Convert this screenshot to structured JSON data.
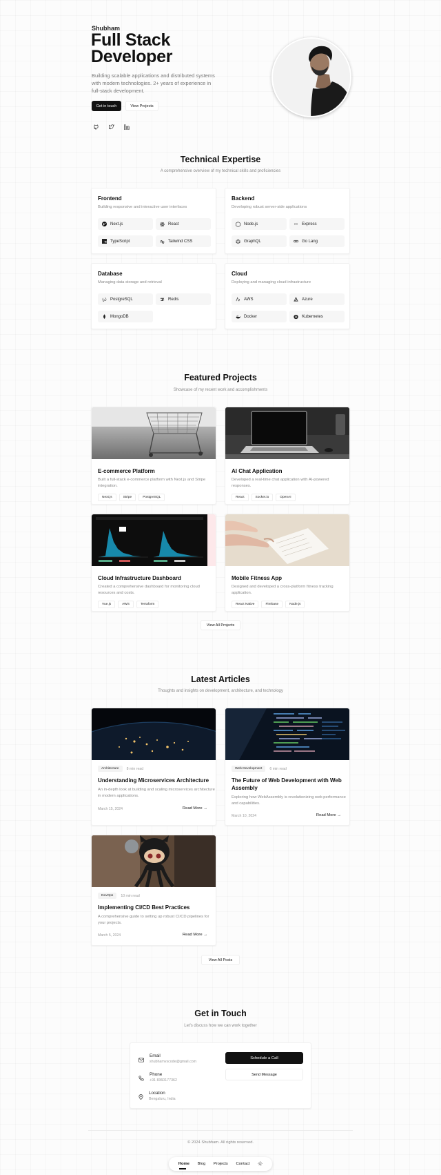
{
  "hero": {
    "name": "Shubham",
    "title_line1": "Full Stack",
    "title_line2": "Developer",
    "description": "Building scalable applications and distributed systems with modern technologies. 2+ years of experience in full-stack development.",
    "primary_button": "Get in touch",
    "secondary_button": "View Projects",
    "social_icons": [
      "github-icon",
      "twitter-icon",
      "linkedin-icon"
    ]
  },
  "skills": {
    "title": "Technical Expertise",
    "subtitle": "A comprehensive overview of my technical skills and proficiencies",
    "cards": [
      {
        "title": "Frontend",
        "desc": "Building responsive and interactive user interfaces",
        "items": [
          "Next.js",
          "React",
          "TypeScript",
          "Tailwind CSS"
        ]
      },
      {
        "title": "Backend",
        "desc": "Developing robust server-side applications",
        "items": [
          "Node.js",
          "Express",
          "GraphQL",
          "Go Lang"
        ]
      },
      {
        "title": "Database",
        "desc": "Managing data storage and retrieval",
        "items": [
          "PostgreSQL",
          "Redis",
          "MongoDB"
        ]
      },
      {
        "title": "Cloud",
        "desc": "Deploying and managing cloud infrastructure",
        "items": [
          "AWS",
          "Azure",
          "Docker",
          "Kubernetes"
        ]
      }
    ]
  },
  "projects": {
    "title": "Featured Projects",
    "subtitle": "Showcase of my recent work and accomplishments",
    "items": [
      {
        "title": "E-commerce Platform",
        "desc": "Built a full-stack e-commerce platform with Next.js and Stripe integration.",
        "tags": [
          "Next.js",
          "Stripe",
          "PostgreSQL"
        ]
      },
      {
        "title": "AI Chat Application",
        "desc": "Developed a real-time chat application with AI-powered responses.",
        "tags": [
          "React",
          "Socket.io",
          "OpenAI"
        ]
      },
      {
        "title": "Cloud Infrastructure Dashboard",
        "desc": "Created a comprehensive dashboard for monitoring cloud resources and costs.",
        "tags": [
          "Vue.js",
          "AWS",
          "Terraform"
        ]
      },
      {
        "title": "Mobile Fitness App",
        "desc": "Designed and developed a cross-platform fitness tracking application.",
        "tags": [
          "React Native",
          "Firebase",
          "Node.js"
        ]
      }
    ],
    "view_all": "View All Projects"
  },
  "articles": {
    "title": "Latest Articles",
    "subtitle": "Thoughts and insights on development, architecture, and technology",
    "items": [
      {
        "category": "Architecture",
        "read_time": "8 min read",
        "title": "Understanding Microservices Architecture",
        "desc": "An in-depth look at building and scaling microservices architecture in modern applications.",
        "date": "March 15, 2024",
        "more": "Read More →"
      },
      {
        "category": "Web Development",
        "read_time": "6 min read",
        "title": "The Future of Web Development with Web Assembly",
        "desc": "Exploring how WebAssembly is revolutionizing web performance and capabilities.",
        "date": "March 10, 2024",
        "more": "Read More →"
      },
      {
        "category": "DevOps",
        "read_time": "10 min read",
        "title": "Implementing CI/CD Best Practices",
        "desc": "A comprehensive guide to setting up robust CI/CD pipelines for your projects.",
        "date": "March 5, 2024",
        "more": "Read More →"
      }
    ],
    "view_all": "View All Posts"
  },
  "contact": {
    "title": "Get in Touch",
    "subtitle": "Let's discuss how we can work together",
    "email_label": "Email",
    "email_value": "shubhamvscode@gmail.com",
    "phone_label": "Phone",
    "phone_value": "+91 8360177362",
    "location_label": "Location",
    "location_value": "Bengaluru, India",
    "schedule_button": "Schedule a Call",
    "message_button": "Send Message"
  },
  "footer": {
    "copyright": "© 2024 Shubham. All rights reserved."
  },
  "nav": {
    "items": [
      "Home",
      "Blog",
      "Projects",
      "Contact"
    ]
  }
}
